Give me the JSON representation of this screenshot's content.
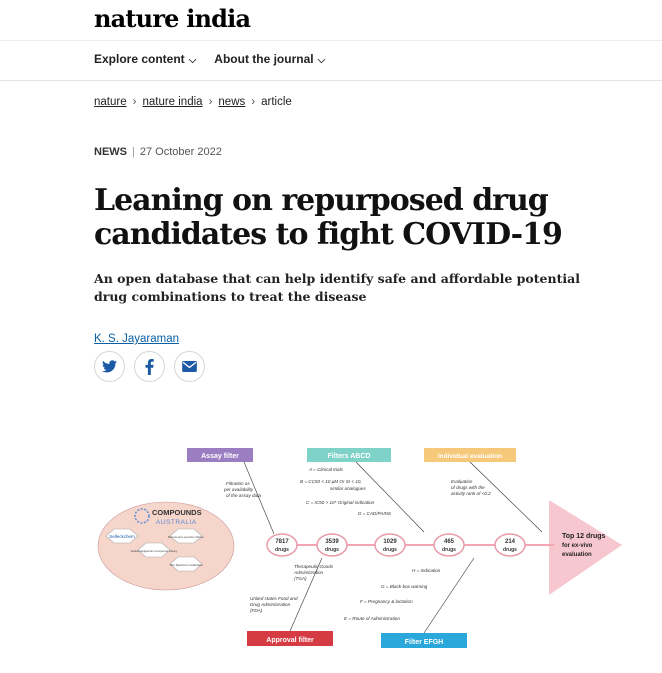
{
  "header": {
    "logo": "nature india",
    "nav": [
      {
        "label": "Explore content"
      },
      {
        "label": "About the journal"
      }
    ]
  },
  "breadcrumb": [
    "nature",
    "nature india",
    "news",
    "article"
  ],
  "article": {
    "type": "NEWS",
    "date": "27 October 2022",
    "title": "Leaning on repurposed drug candidates to fight COVID-19",
    "standfirst": "An open database that can help identify safe and affordable potential drug combinations to treat the disease",
    "author": "K. S. Jayaraman"
  },
  "share": {
    "icons": [
      "twitter-icon",
      "facebook-icon",
      "email-icon"
    ],
    "colors": {
      "icon": "#1d5aa6"
    }
  },
  "figure": {
    "headers": {
      "assay": "Assay filter",
      "abcd": "Filters ABCD",
      "individual": "Individual evaluation",
      "approval": "Approval filter",
      "efgh": "Filter EFGH"
    },
    "colors": {
      "assay": "#9b7ec1",
      "abcd": "#7fd2c8",
      "individual": "#f5c87a",
      "approval": "#d43b43",
      "efgh": "#2aa7db",
      "ellipse": "#f6d5cb",
      "arrow": "#f7c7cf"
    },
    "compounds": {
      "title": "COMPOUNDS",
      "subtitle": "AUSTRALIA"
    },
    "libraries": [
      "Selleckchem",
      "Microsource spectrum library",
      "Selleck Epigenetic Compound Library",
      "The Spectrum Collection"
    ],
    "counts": [
      {
        "value": "7817",
        "unit": "drugs"
      },
      {
        "value": "3539",
        "unit": "drugs"
      },
      {
        "value": "1029",
        "unit": "drugs"
      },
      {
        "value": "465",
        "unit": "drugs"
      },
      {
        "value": "214",
        "unit": "drugs"
      }
    ],
    "result": [
      "Top 12 drugs",
      "for ex-vivo",
      "evaluation"
    ],
    "notes": {
      "assay": [
        "Filtration as",
        "per availability",
        "of the assay data"
      ],
      "a": "A = Clinical trials",
      "b1": "B = CC50 < 10 µM Or SI < 10,",
      "b2": "similar analogues",
      "c": "C = IC50 > 10* Original indication",
      "d": "D = CAD/PAINS",
      "individual": [
        "Evaluation",
        "of drugs with the",
        "activity rank of <0.2"
      ],
      "tga": [
        "Therapeutic Goods",
        "Administration",
        "(TGA)"
      ],
      "fda": [
        "United states Food and",
        "Drug Administration",
        "(FDA)"
      ],
      "h": "H = Indication",
      "g": "G = Black-box warning",
      "f": "F = Pregnancy & lactation",
      "e": "E = Route of Administration"
    }
  }
}
